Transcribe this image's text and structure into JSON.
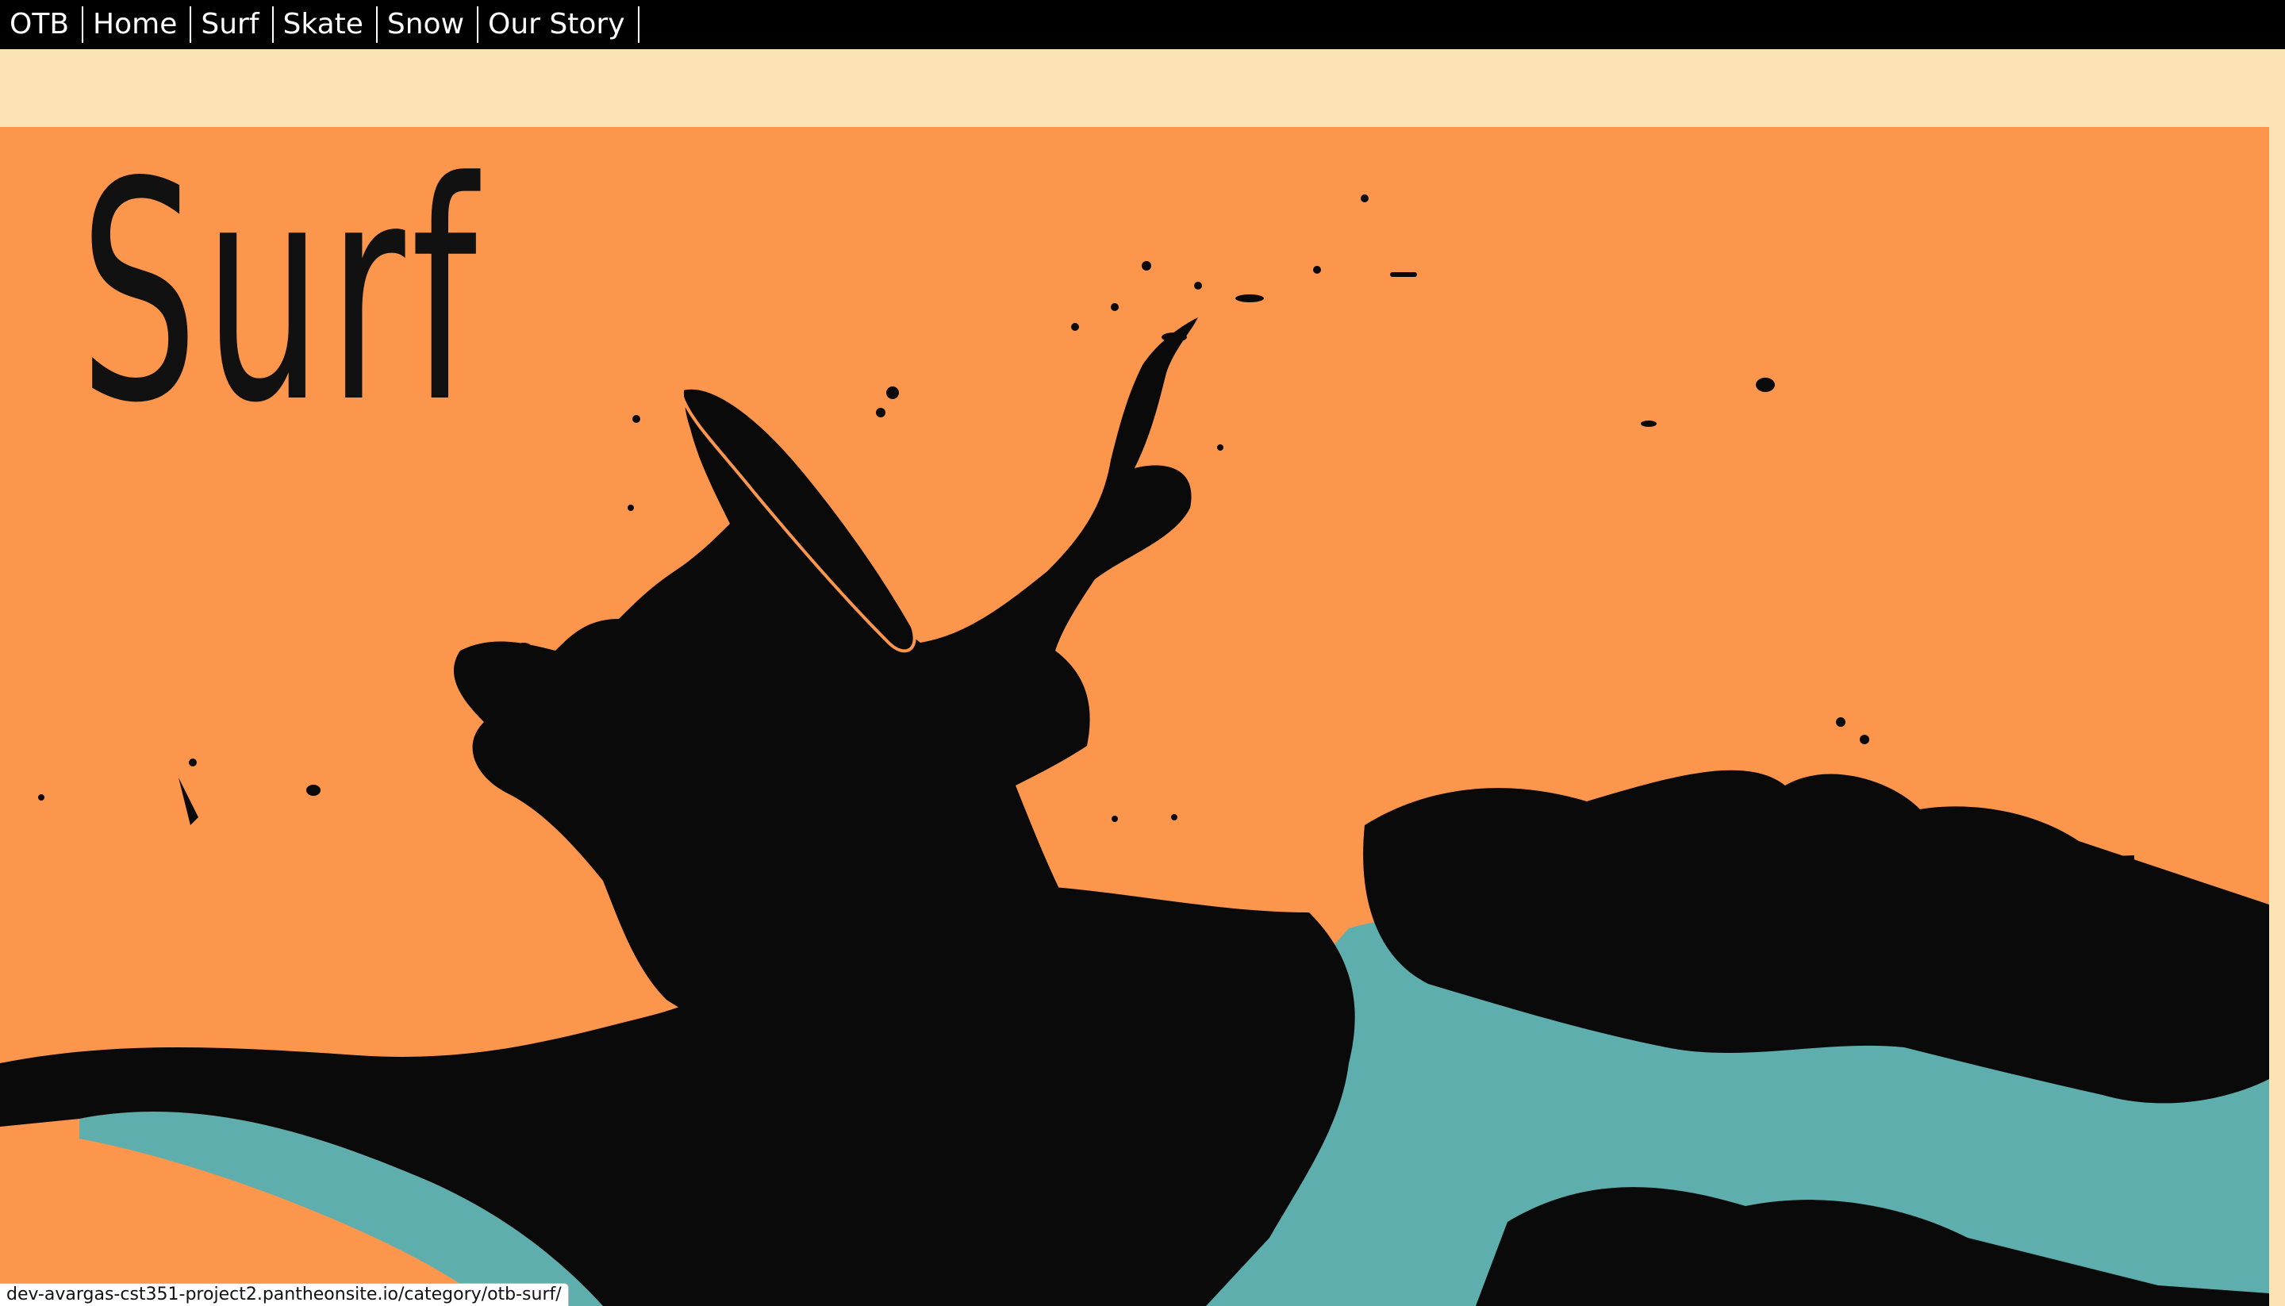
{
  "nav": {
    "items": [
      {
        "label": "OTB"
      },
      {
        "label": "Home"
      },
      {
        "label": "Surf"
      },
      {
        "label": "Skate"
      },
      {
        "label": "Snow"
      },
      {
        "label": "Our Story"
      }
    ]
  },
  "hero": {
    "title": "Surf",
    "image_name": "surfer-silhouette-artwork"
  },
  "status_bar": {
    "url": "dev-avargas-cst351-project2.pantheonsite.io/category/otb-surf/"
  },
  "colors": {
    "nav_bg": "#000000",
    "cream": "#fbe3b6",
    "orange": "#fc964d",
    "teal": "#5faeae",
    "ink": "#0a0a0a"
  }
}
